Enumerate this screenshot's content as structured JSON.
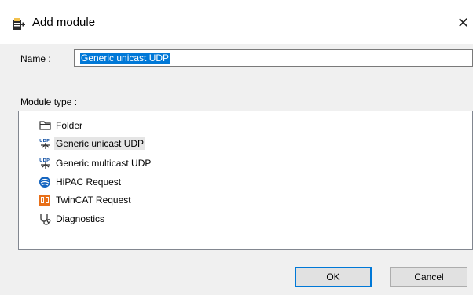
{
  "dialog": {
    "title": "Add module",
    "close_glyph": "✕"
  },
  "name_field": {
    "label": "Name :",
    "value": "Generic unicast UDP"
  },
  "module_type": {
    "label": "Module type :",
    "items": [
      {
        "label": "Folder",
        "icon": "folder-icon",
        "selected": false
      },
      {
        "label": "Generic unicast UDP",
        "icon": "udp-icon",
        "selected": true
      },
      {
        "label": "Generic multicast UDP",
        "icon": "udp-icon",
        "selected": false
      },
      {
        "label": "HiPAC Request",
        "icon": "hipac-icon",
        "selected": false
      },
      {
        "label": "TwinCAT Request",
        "icon": "twincat-icon",
        "selected": false
      },
      {
        "label": "Diagnostics",
        "icon": "diagnostics-icon",
        "selected": false
      }
    ]
  },
  "buttons": {
    "ok_label": "OK",
    "cancel_label": "Cancel"
  },
  "colors": {
    "selection": "#0078d7",
    "dialog_background": "#f0f0f0"
  }
}
